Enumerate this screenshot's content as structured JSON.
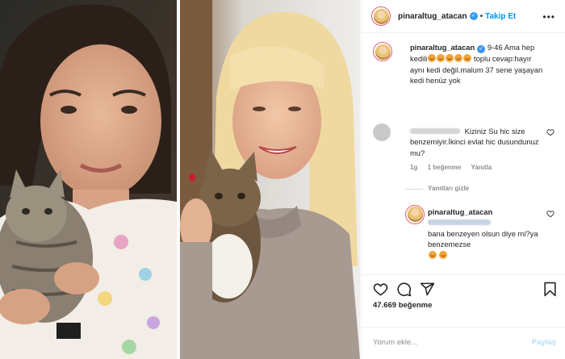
{
  "colors": {
    "accent": "#0095f6",
    "verified": "#3897f0",
    "muted": "#8e8e8e",
    "text": "#262626"
  },
  "post": {
    "author": "pinaraltug_atacan",
    "verified": true,
    "follow_label": "Takip Et",
    "more_icon": "more-horizontal-icon",
    "images": [
      {
        "name": "photo-childhood-with-kitten"
      },
      {
        "name": "photo-adult-with-cat"
      }
    ]
  },
  "comments": [
    {
      "author": "pinaraltug_atacan",
      "text_before": "9-46 Ama hep kedili",
      "text_after": "toplu cevap:hayır aynı kedi değil.malum 37 sene yaşayan kedi henüz yok"
    },
    {
      "text": "Kiziniz Su hic size benzemiyir.İkinci evlat hic dusundunuz mu?",
      "age": "1g",
      "likes": "1 beğenme",
      "reply_label": "Yanıtla"
    }
  ],
  "replies_toggle": "Yanıtları gizle",
  "reply": {
    "author": "pinaraltug_atacan",
    "text": "bana benzeyen olsun diye mi?ya benzemezse"
  },
  "actions": {
    "like_icon": "heart-icon",
    "comment_icon": "comment-icon",
    "share_icon": "share-icon",
    "save_icon": "bookmark-icon",
    "likes_count": "47.669 beğenme"
  },
  "comment_input": {
    "placeholder": "Yorum ekle...",
    "post_label": "Paylaş"
  }
}
